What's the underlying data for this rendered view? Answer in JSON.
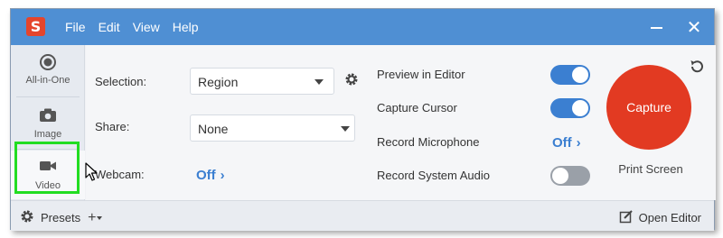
{
  "titlebar": {
    "logo_letter": "S",
    "menu": [
      "File",
      "Edit",
      "View",
      "Help"
    ],
    "close_glyph": "✕"
  },
  "sidebar": {
    "items": [
      {
        "label": "All-in-One",
        "icon": "all-in-one-icon"
      },
      {
        "label": "Image",
        "icon": "camera-icon"
      },
      {
        "label": "Video",
        "icon": "video-camera-icon"
      }
    ]
  },
  "settings": {
    "selection_label": "Selection:",
    "selection_value": "Region",
    "share_label": "Share:",
    "share_value": "None",
    "webcam_label": "Webcam:",
    "webcam_value": "Off"
  },
  "options": {
    "preview_label": "Preview in Editor",
    "preview_state": "on",
    "cursor_label": "Capture Cursor",
    "cursor_state": "on",
    "mic_label": "Record Microphone",
    "mic_value": "Off",
    "audio_label": "Record System Audio",
    "audio_state": "off"
  },
  "capture": {
    "button_label": "Capture",
    "shortcut": "Print Screen"
  },
  "bottom": {
    "presets_label": "Presets",
    "add_glyph": "+",
    "open_editor_label": "Open Editor"
  },
  "colors": {
    "titlebar": "#4f8fd3",
    "accent": "#3b7fd1",
    "capture": "#e23a22",
    "highlight": "#22dd22"
  }
}
